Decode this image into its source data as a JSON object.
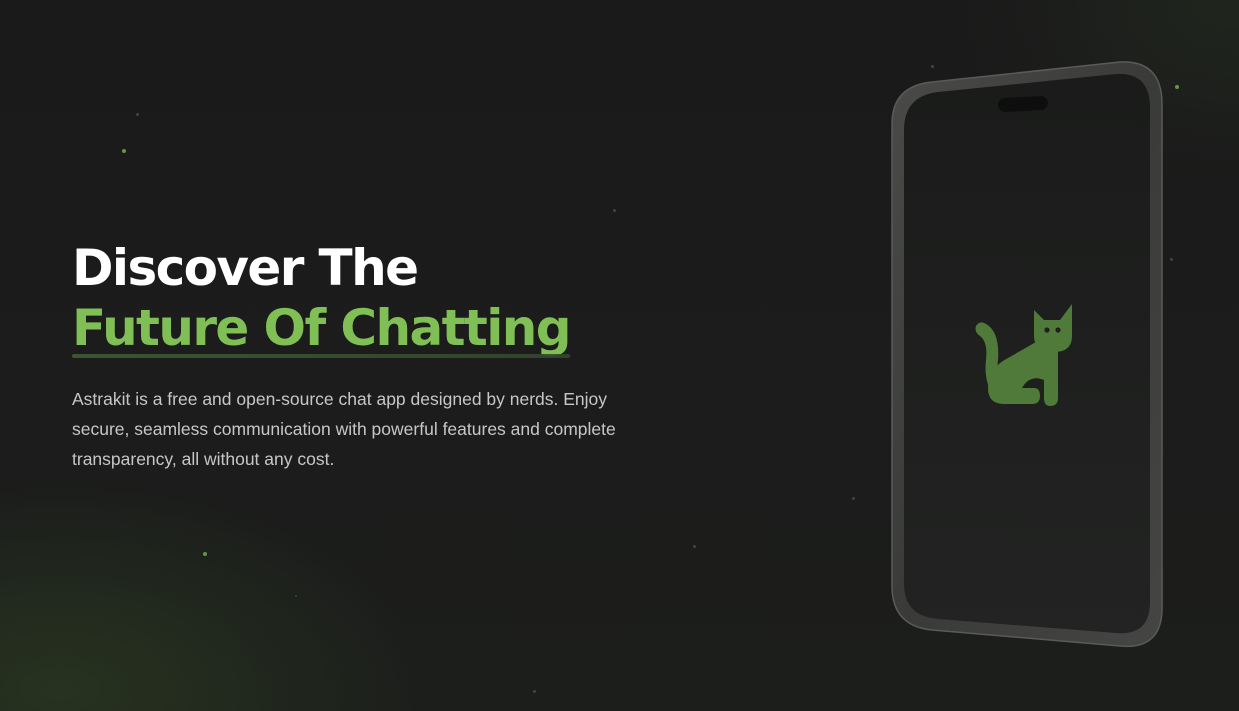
{
  "hero": {
    "headline_line1": "Discover The",
    "headline_line2": "Future Of Chatting",
    "description": "Astrakit is a free and open-source chat app designed by nerds. Enjoy secure, seamless communication with powerful features and complete transparency, all without any cost."
  },
  "phone": {
    "screen_icon": "cat-icon"
  },
  "colors": {
    "background": "#1b1c1b",
    "headline_white": "#ffffff",
    "headline_accent": "#7fbf55",
    "description": "#c7c7c7",
    "phone_frame": "#3d3e3c",
    "phone_screen": "#1e1f1e",
    "cat": "#4f7a3a",
    "particle": "#5e9a3f"
  }
}
